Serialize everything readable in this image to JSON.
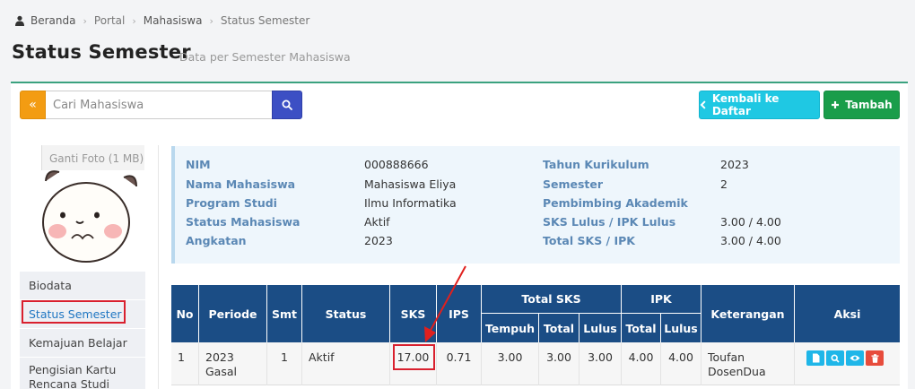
{
  "breadcrumb": [
    "Beranda",
    "Portal",
    "Mahasiswa",
    "Status Semester"
  ],
  "page": {
    "title": "Status Semester",
    "subtitle": "Data per Semester Mahasiswa"
  },
  "search": {
    "placeholder": "Cari Mahasiswa",
    "addon_icon": "«"
  },
  "buttons": {
    "back": "Kembali ke Daftar",
    "add": "Tambah"
  },
  "photo": {
    "label": "Ganti Foto (1 MB)"
  },
  "sidebar": {
    "items": [
      {
        "label": "Biodata"
      },
      {
        "label": "Status Semester"
      },
      {
        "label": "Kemajuan Belajar"
      },
      {
        "label": "Pengisian Kartu Rencana Studi"
      }
    ]
  },
  "info": {
    "left": [
      {
        "label": "NIM",
        "value": "000888666"
      },
      {
        "label": "Nama Mahasiswa",
        "value": "Mahasiswa Eliya"
      },
      {
        "label": "Program Studi",
        "value": "Ilmu Informatika"
      },
      {
        "label": "Status Mahasiswa",
        "value": "Aktif"
      },
      {
        "label": "Angkatan",
        "value": "2023"
      }
    ],
    "right": [
      {
        "label": "Tahun Kurikulum",
        "value": "2023"
      },
      {
        "label": "Semester",
        "value": "2"
      },
      {
        "label": "Pembimbing Akademik",
        "value": ""
      },
      {
        "label": "SKS Lulus / IPK Lulus",
        "value": "3.00 / 4.00"
      },
      {
        "label": "Total SKS / IPK",
        "value": "3.00 / 4.00"
      }
    ]
  },
  "table": {
    "headers": {
      "no": "No",
      "periode": "Periode",
      "smt": "Smt",
      "status": "Status",
      "sks": "SKS",
      "ips": "IPS",
      "total_sks": "Total SKS",
      "tempuh": "Tempuh",
      "total": "Total",
      "lulus": "Lulus",
      "ipk": "IPK",
      "ipk_total": "Total",
      "ipk_lulus": "Lulus",
      "keterangan": "Keterangan",
      "aksi": "Aksi"
    },
    "rows": [
      {
        "no": "1",
        "periode": "2023 Gasal",
        "smt": "1",
        "status": "Aktif",
        "sks": "17.00",
        "ips": "0.71",
        "tempuh": "3.00",
        "total": "3.00",
        "lulus": "3.00",
        "ipk_total": "4.00",
        "ipk_lulus": "4.00",
        "keterangan": "Toufan DosenDua"
      }
    ]
  },
  "colors": {
    "warning": "#f39c12",
    "primary": "#3c4fc4",
    "info": "#1fc8e3",
    "success": "#1a9d4a",
    "header": "#1b4d85",
    "danger": "#e74c3c",
    "highlight": "#d9202e"
  }
}
